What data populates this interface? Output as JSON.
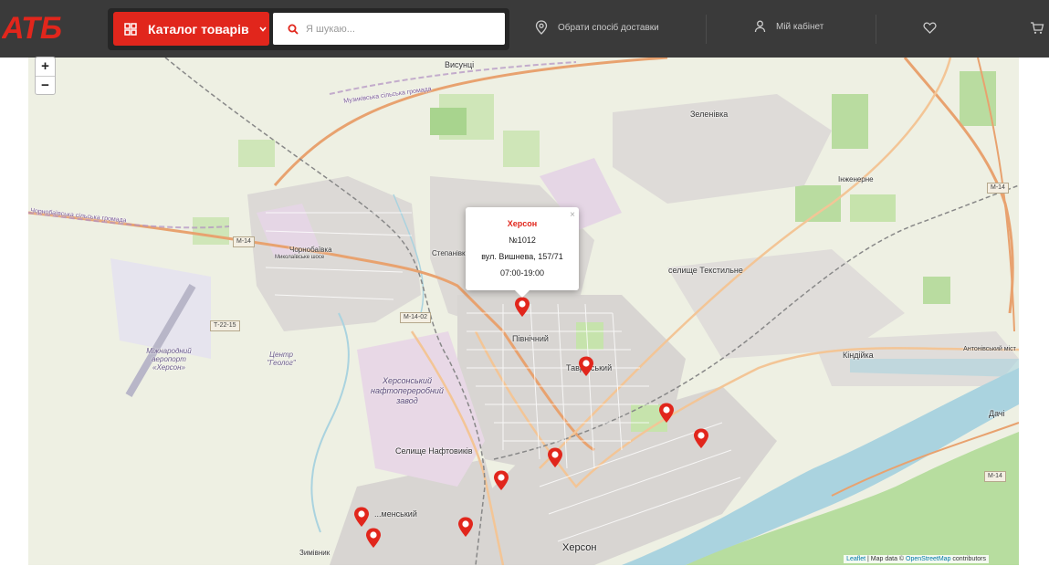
{
  "header": {
    "logo_text": "АТБ",
    "catalog_label": "Каталог товарів",
    "search_placeholder": "Я шукаю...",
    "delivery_label": "Обрати спосіб доставки",
    "account_label": "Мій кабінет",
    "icons": [
      "catalog-grid-icon",
      "chevron-down-icon",
      "search-icon",
      "location-icon",
      "user-icon",
      "heart-icon",
      "cart-icon"
    ],
    "colors": {
      "brand_red": "#e1261c",
      "header_bg": "#3a3a3a"
    }
  },
  "map": {
    "zoom_in": "+",
    "zoom_out": "−",
    "popup": {
      "city": "Херсон",
      "store_number": "№1012",
      "address": "вул. Вишнева, 157/71",
      "hours": "07:00-19:00",
      "close": "×"
    },
    "labels": {
      "visuntsi": "Висунці",
      "muzykivska": "Музиківська сільська громада",
      "zelenivka": "Зеленівка",
      "inzhenerne": "Інженерне",
      "chornobaivska": "Чорнобаївська сільська громада",
      "chornobaivka": "Чорнобаївка",
      "mykolaivske": "Миколаївське шосе",
      "stepanivka": "Степанівка",
      "tekstylne": "селище Текстильне",
      "pivnichnyi": "Північний",
      "tavriiskyi": "Таврійський",
      "kindiika": "Кіндійка",
      "antonivskyi": "Антонівський міст",
      "dachi": "Дачі",
      "airport": "Міжнародний аеропорт «Херсон»",
      "tsentr": "Центр \"Геолог\"",
      "refinery": "Херсонський нафтопереробний завод",
      "naftovykiv": "Селище Нафтовиків",
      "kamianskyi": "...менський",
      "zymivnyk": "Зимівник",
      "kherson": "Херсон"
    },
    "shields": [
      "М-14",
      "М-14",
      "М-14",
      "Т-22-15",
      "М-14-02"
    ],
    "attribution": {
      "leaflet": "Leaflet",
      "text": " | Map data © ",
      "osm": "OpenStreetMap",
      "contributors": " contributors"
    },
    "pin_count": 11,
    "pin_color": "#e1261c"
  }
}
